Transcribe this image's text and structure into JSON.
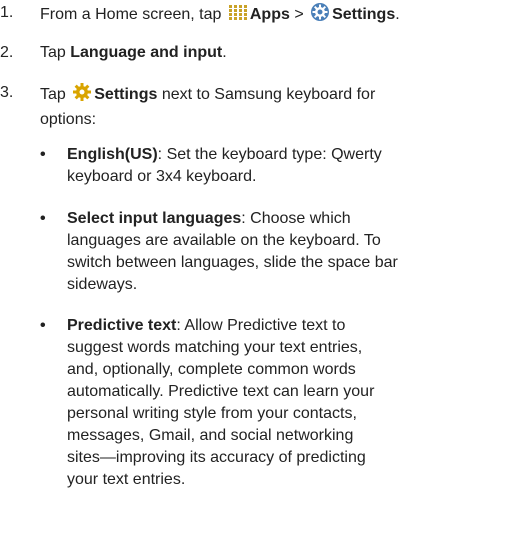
{
  "steps": [
    {
      "number": "1.",
      "prefix": "From a Home screen, tap",
      "apps_label": "Apps",
      "separator": ">",
      "settings_label": "Settings",
      "suffix": "."
    },
    {
      "number": "2.",
      "prefix": "Tap",
      "bold": "Language and input",
      "suffix": "."
    },
    {
      "number": "3.",
      "prefix": "Tap",
      "bold": "Settings",
      "suffix_line1": "next to Samsung keyboard for",
      "suffix_line2": "options:"
    }
  ],
  "bullets": [
    {
      "dot": "•",
      "term": "English(US)",
      "lines": [
        ": Set the keyboard type: Qwerty",
        "keyboard or 3x4 keyboard."
      ]
    },
    {
      "dot": "•",
      "term": "Select input languages",
      "lines": [
        ": Choose which",
        "languages are available on the keyboard. To",
        "switch between languages, slide the space bar",
        "sideways."
      ]
    },
    {
      "dot": "•",
      "term": "Predictive text",
      "lines": [
        ": Allow Predictive text to",
        "suggest words matching your text entries,",
        "and, optionally, complete common words",
        "automatically. Predictive text can learn your",
        "personal writing style from your contacts,",
        "messages, Gmail, and social networking",
        "sites—improving its accuracy of predicting",
        "your text entries."
      ]
    }
  ],
  "icons": {
    "apps": "apps-grid-icon",
    "settings_blue": "settings-gear-icon",
    "settings_yellow": "settings-gear-icon",
    "apps_color": "#c9a227",
    "settings_blue_color": "#4a7fb8",
    "settings_yellow_color": "#d9a400"
  }
}
